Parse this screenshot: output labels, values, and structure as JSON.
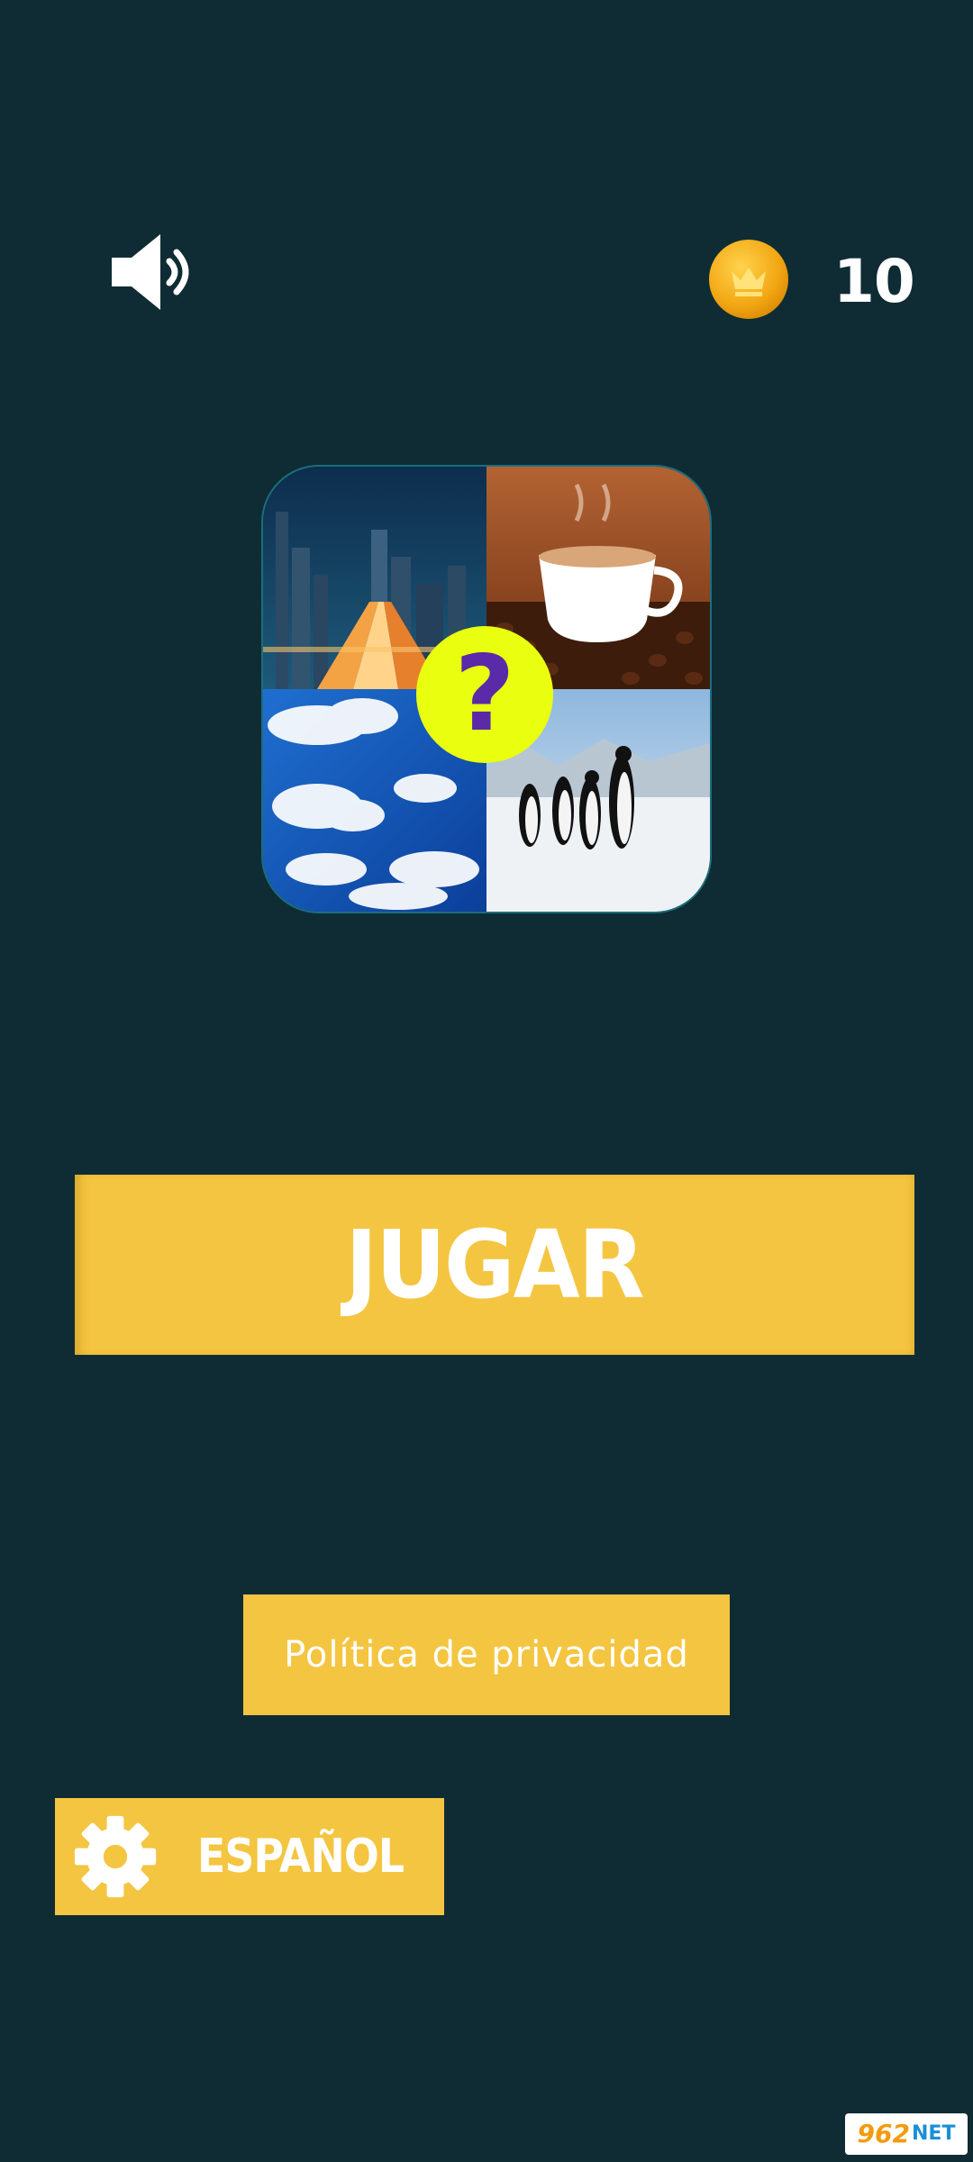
{
  "header": {
    "sound_icon": "speaker-on-icon",
    "coin_icon": "crown-coin-icon",
    "coin_count": "10"
  },
  "logo": {
    "tiles": [
      "city-night-image",
      "coffee-cup-image",
      "sky-clouds-image",
      "penguins-image"
    ],
    "badge_text": "?"
  },
  "play": {
    "label": "JUGAR"
  },
  "privacy": {
    "label": "Política de privacidad"
  },
  "language": {
    "icon": "gear-icon",
    "label": "ESPAÑOL"
  },
  "watermark": {
    "number": "962",
    "suffix": "NET"
  },
  "colors": {
    "background": "#0f2c35",
    "button": "#f4c540",
    "coin": "#f2a612",
    "badge": "#eaff0f",
    "badge_text": "#5a2aa8"
  }
}
